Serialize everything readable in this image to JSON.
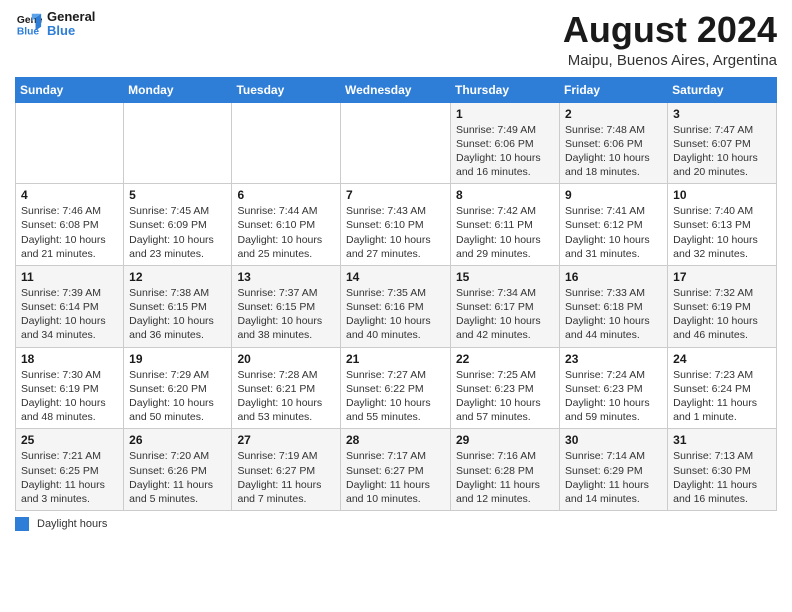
{
  "header": {
    "logo_line1": "General",
    "logo_line2": "Blue",
    "month_title": "August 2024",
    "location": "Maipu, Buenos Aires, Argentina"
  },
  "days_of_week": [
    "Sunday",
    "Monday",
    "Tuesday",
    "Wednesday",
    "Thursday",
    "Friday",
    "Saturday"
  ],
  "legend": {
    "label": "Daylight hours"
  },
  "weeks": [
    [
      {
        "day": "",
        "info": ""
      },
      {
        "day": "",
        "info": ""
      },
      {
        "day": "",
        "info": ""
      },
      {
        "day": "",
        "info": ""
      },
      {
        "day": "1",
        "info": "Sunrise: 7:49 AM\nSunset: 6:06 PM\nDaylight: 10 hours\nand 16 minutes."
      },
      {
        "day": "2",
        "info": "Sunrise: 7:48 AM\nSunset: 6:06 PM\nDaylight: 10 hours\nand 18 minutes."
      },
      {
        "day": "3",
        "info": "Sunrise: 7:47 AM\nSunset: 6:07 PM\nDaylight: 10 hours\nand 20 minutes."
      }
    ],
    [
      {
        "day": "4",
        "info": "Sunrise: 7:46 AM\nSunset: 6:08 PM\nDaylight: 10 hours\nand 21 minutes."
      },
      {
        "day": "5",
        "info": "Sunrise: 7:45 AM\nSunset: 6:09 PM\nDaylight: 10 hours\nand 23 minutes."
      },
      {
        "day": "6",
        "info": "Sunrise: 7:44 AM\nSunset: 6:10 PM\nDaylight: 10 hours\nand 25 minutes."
      },
      {
        "day": "7",
        "info": "Sunrise: 7:43 AM\nSunset: 6:10 PM\nDaylight: 10 hours\nand 27 minutes."
      },
      {
        "day": "8",
        "info": "Sunrise: 7:42 AM\nSunset: 6:11 PM\nDaylight: 10 hours\nand 29 minutes."
      },
      {
        "day": "9",
        "info": "Sunrise: 7:41 AM\nSunset: 6:12 PM\nDaylight: 10 hours\nand 31 minutes."
      },
      {
        "day": "10",
        "info": "Sunrise: 7:40 AM\nSunset: 6:13 PM\nDaylight: 10 hours\nand 32 minutes."
      }
    ],
    [
      {
        "day": "11",
        "info": "Sunrise: 7:39 AM\nSunset: 6:14 PM\nDaylight: 10 hours\nand 34 minutes."
      },
      {
        "day": "12",
        "info": "Sunrise: 7:38 AM\nSunset: 6:15 PM\nDaylight: 10 hours\nand 36 minutes."
      },
      {
        "day": "13",
        "info": "Sunrise: 7:37 AM\nSunset: 6:15 PM\nDaylight: 10 hours\nand 38 minutes."
      },
      {
        "day": "14",
        "info": "Sunrise: 7:35 AM\nSunset: 6:16 PM\nDaylight: 10 hours\nand 40 minutes."
      },
      {
        "day": "15",
        "info": "Sunrise: 7:34 AM\nSunset: 6:17 PM\nDaylight: 10 hours\nand 42 minutes."
      },
      {
        "day": "16",
        "info": "Sunrise: 7:33 AM\nSunset: 6:18 PM\nDaylight: 10 hours\nand 44 minutes."
      },
      {
        "day": "17",
        "info": "Sunrise: 7:32 AM\nSunset: 6:19 PM\nDaylight: 10 hours\nand 46 minutes."
      }
    ],
    [
      {
        "day": "18",
        "info": "Sunrise: 7:30 AM\nSunset: 6:19 PM\nDaylight: 10 hours\nand 48 minutes."
      },
      {
        "day": "19",
        "info": "Sunrise: 7:29 AM\nSunset: 6:20 PM\nDaylight: 10 hours\nand 50 minutes."
      },
      {
        "day": "20",
        "info": "Sunrise: 7:28 AM\nSunset: 6:21 PM\nDaylight: 10 hours\nand 53 minutes."
      },
      {
        "day": "21",
        "info": "Sunrise: 7:27 AM\nSunset: 6:22 PM\nDaylight: 10 hours\nand 55 minutes."
      },
      {
        "day": "22",
        "info": "Sunrise: 7:25 AM\nSunset: 6:23 PM\nDaylight: 10 hours\nand 57 minutes."
      },
      {
        "day": "23",
        "info": "Sunrise: 7:24 AM\nSunset: 6:23 PM\nDaylight: 10 hours\nand 59 minutes."
      },
      {
        "day": "24",
        "info": "Sunrise: 7:23 AM\nSunset: 6:24 PM\nDaylight: 11 hours\nand 1 minute."
      }
    ],
    [
      {
        "day": "25",
        "info": "Sunrise: 7:21 AM\nSunset: 6:25 PM\nDaylight: 11 hours\nand 3 minutes."
      },
      {
        "day": "26",
        "info": "Sunrise: 7:20 AM\nSunset: 6:26 PM\nDaylight: 11 hours\nand 5 minutes."
      },
      {
        "day": "27",
        "info": "Sunrise: 7:19 AM\nSunset: 6:27 PM\nDaylight: 11 hours\nand 7 minutes."
      },
      {
        "day": "28",
        "info": "Sunrise: 7:17 AM\nSunset: 6:27 PM\nDaylight: 11 hours\nand 10 minutes."
      },
      {
        "day": "29",
        "info": "Sunrise: 7:16 AM\nSunset: 6:28 PM\nDaylight: 11 hours\nand 12 minutes."
      },
      {
        "day": "30",
        "info": "Sunrise: 7:14 AM\nSunset: 6:29 PM\nDaylight: 11 hours\nand 14 minutes."
      },
      {
        "day": "31",
        "info": "Sunrise: 7:13 AM\nSunset: 6:30 PM\nDaylight: 11 hours\nand 16 minutes."
      }
    ]
  ]
}
